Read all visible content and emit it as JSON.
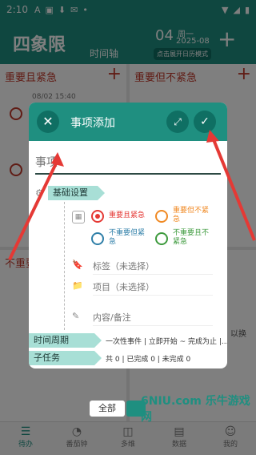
{
  "status_bar": {
    "time": "2:10",
    "icons": [
      "A",
      "▣",
      "⬇",
      "✉",
      "•"
    ],
    "right_icons": [
      "▼",
      "◢",
      "▮"
    ]
  },
  "app_bar": {
    "title": "四象限",
    "subtitle": "时间轴",
    "date_day": "04",
    "date_week": "周一",
    "date_year_month": "2025-08",
    "calendar_button": "点击展开日历模式",
    "add_label": "+"
  },
  "quadrants": {
    "q1": {
      "title": "重要且紧急",
      "plus": "+",
      "task_time": "08/02 15:40"
    },
    "q2": {
      "title": "重要但不紧急",
      "plus": "+"
    },
    "q3": {
      "title": "不重要",
      "plus": "+"
    },
    "q4": {
      "title": "以换"
    }
  },
  "dialog": {
    "close_icon": "✕",
    "title": "事项添加",
    "expand_icon": "⤢",
    "confirm_icon": "✓",
    "input_placeholder": "事项",
    "basic_settings_label": "基础设置",
    "priority_options": [
      {
        "label": "重要且紧急",
        "color": "#e53935",
        "selected": true
      },
      {
        "label": "重要但不紧急",
        "color": "#f08a24",
        "selected": false
      },
      {
        "label": "不重要但紧急",
        "color": "#2f7fa8",
        "selected": false
      },
      {
        "label": "不重要且不紧急",
        "color": "#3d9a3d",
        "selected": false
      }
    ],
    "tag_row": "标签（未选择）",
    "project_row": "项目（未选择）",
    "notes_row": "内容/备注",
    "period_label": "时间周期",
    "period_value": "一次性事件 | 立即开始 ~ 完成为止 |...",
    "subtask_label": "子任务",
    "subtask_value": "共 0 | 已完成 0 | 未完成 0"
  },
  "under_dialog": {
    "all_button": "全部"
  },
  "bottom_nav": [
    {
      "label": "待办",
      "icon": "☰",
      "active": true
    },
    {
      "label": "番茄钟",
      "icon": "◔",
      "active": false
    },
    {
      "label": "多维",
      "icon": "◫",
      "active": false
    },
    {
      "label": "数据",
      "icon": "▤",
      "active": false
    },
    {
      "label": "我的",
      "icon": "☺",
      "active": false
    }
  ],
  "watermark": "6NIU.com 乐牛游戏网"
}
